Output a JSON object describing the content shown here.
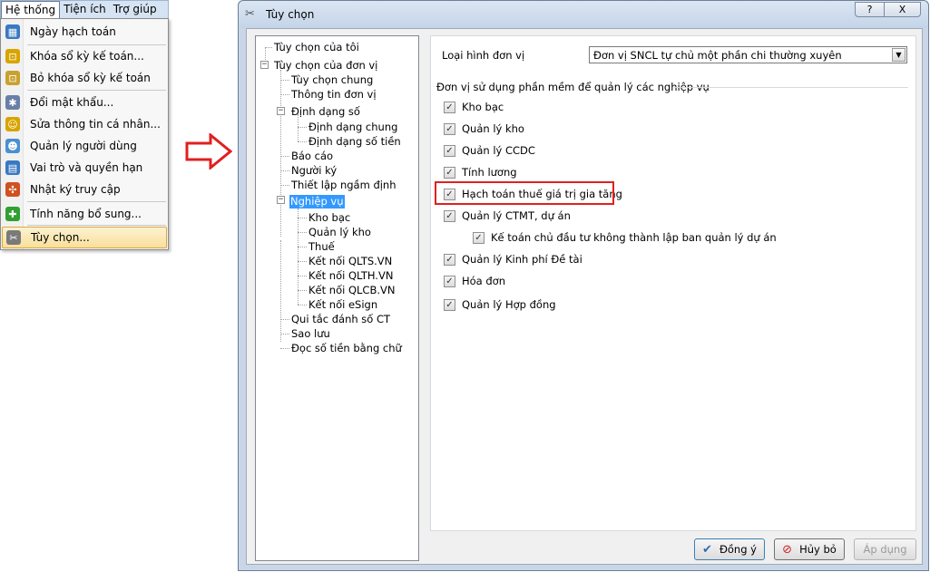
{
  "menu": {
    "bar": [
      "Hệ thống",
      "Tiện ích",
      "Trợ giúp"
    ],
    "items": [
      {
        "label": "Ngày hạch toán",
        "icon": "calendar-icon",
        "color": "#3a78c2"
      },
      {
        "label": "Khóa sổ kỳ kế toán...",
        "icon": "lock-icon",
        "color": "#d8a400"
      },
      {
        "label": "Bỏ khóa sổ kỳ kế toán",
        "icon": "unlock-icon",
        "color": "#c9a130"
      },
      {
        "label": "Đổi mật khẩu...",
        "icon": "password-icon",
        "color": "#6a7fa8"
      },
      {
        "label": "Sửa thông tin cá nhân...",
        "icon": "user-edit-icon",
        "color": "#d8a400"
      },
      {
        "label": "Quản lý người dùng",
        "icon": "users-icon",
        "color": "#4a90d0"
      },
      {
        "label": "Vai trò và quyền hạn",
        "icon": "role-icon",
        "color": "#3a78c2"
      },
      {
        "label": "Nhật ký truy cập",
        "icon": "footprints-icon",
        "color": "#d05020"
      },
      {
        "label": "Tính năng bổ sung...",
        "icon": "puzzle-icon",
        "color": "#30a030"
      },
      {
        "label": "Tùy chọn...",
        "icon": "tools-icon",
        "color": "#7a7a7a"
      }
    ]
  },
  "dialog": {
    "title": "Tùy chọn",
    "help_label": "?",
    "close_label": "X",
    "tree": [
      "Tùy chọn của tôi",
      "Tùy chọn của đơn vị",
      "Tùy chọn chung",
      "Thông tin đơn vị",
      "Định dạng số",
      "Định dạng chung",
      "Định dạng số tiền",
      "Báo cáo",
      "Người ký",
      "Thiết lập ngầm định",
      "Nghiệp vụ",
      "Kho bạc",
      "Quản lý kho",
      "Thuế",
      "Kết nối QLTS.VN",
      "Kết nối QLTH.VN",
      "Kết nối QLCB.VN",
      "Kết nối eSign",
      "Qui tắc đánh số CT",
      "Sao lưu",
      "Đọc số tiền bằng chữ"
    ],
    "unit_type_label": "Loại hình đơn vị",
    "unit_type_value": "Đơn vị SNCL tự chủ một phần chi thường xuyên",
    "group_label": "Đơn vị sử dụng phần mềm để quản lý các nghiệp vụ",
    "checks": [
      {
        "label": "Kho bạc",
        "checked": true
      },
      {
        "label": "Quản lý kho",
        "checked": true
      },
      {
        "label": "Quản lý CCDC",
        "checked": true
      },
      {
        "label": "Tính lương",
        "checked": true
      },
      {
        "label": "Hạch toán thuế giá trị gia tăng",
        "checked": true
      },
      {
        "label": "Quản lý CTMT, dự án",
        "checked": true
      },
      {
        "label": "Kế toán chủ đầu tư không thành lập ban quản lý dự án",
        "checked": true
      },
      {
        "label": "Quản lý Kinh phí Đề tài",
        "checked": true
      },
      {
        "label": "Hóa đơn",
        "checked": true
      },
      {
        "label": "Quản lý Hợp đồng",
        "checked": true
      }
    ],
    "buttons": {
      "ok": "Đồng ý",
      "cancel": "Hủy bỏ",
      "apply": "Áp dụng"
    }
  }
}
